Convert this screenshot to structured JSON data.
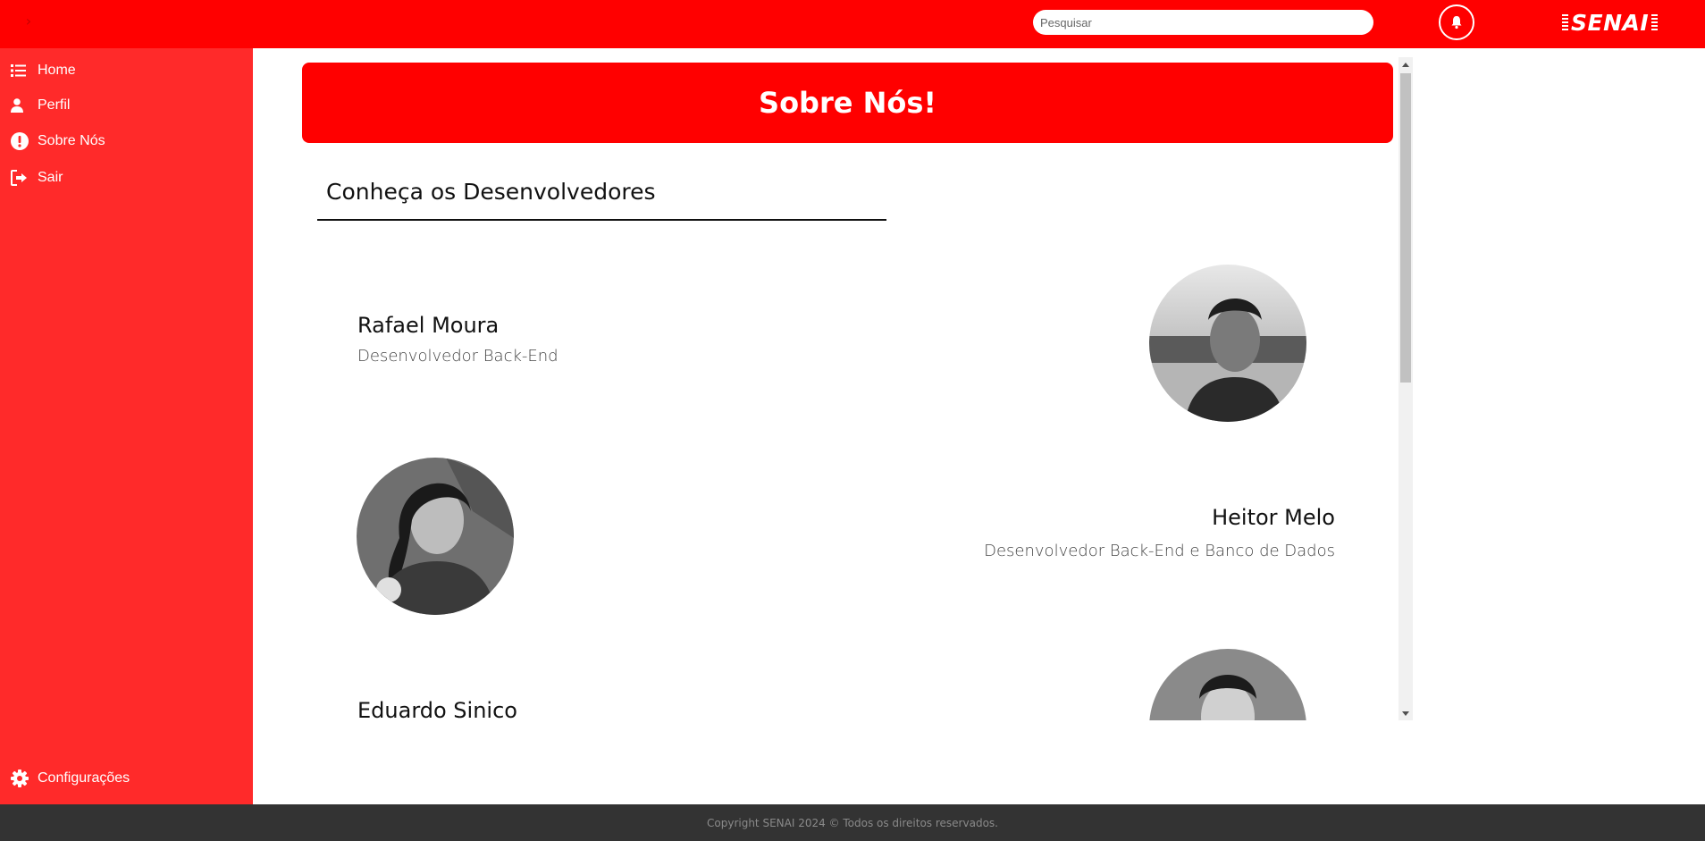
{
  "header": {
    "search_placeholder": "Pesquisar",
    "logo_text": "SENAI",
    "menu_toggle_glyph": "›",
    "accent_color": "#ff0000"
  },
  "sidebar": {
    "background_color": "#ff2a2a",
    "items": [
      {
        "label": "Home",
        "icon": "list-icon"
      },
      {
        "label": "Perfil",
        "icon": "user-icon"
      },
      {
        "label": "Sobre Nós",
        "icon": "exclamation-circle-icon"
      },
      {
        "label": "Sair",
        "icon": "sign-out-icon"
      }
    ],
    "settings": {
      "label": "Configurações",
      "icon": "gear-icon"
    }
  },
  "main": {
    "banner_title": "Sobre Nós!",
    "section_title": "Conheça os Desenvolvedores",
    "developers": [
      {
        "name": "Rafael Moura",
        "role": "Desenvolvedor Back-End"
      },
      {
        "name": "Heitor Melo",
        "role": "Desenvolvedor Back-End e Banco de Dados"
      },
      {
        "name": "Eduardo Sinico",
        "role": ""
      }
    ]
  },
  "footer": {
    "copyright": "Copyright SENAI 2024 © Todos os direitos reservados."
  }
}
